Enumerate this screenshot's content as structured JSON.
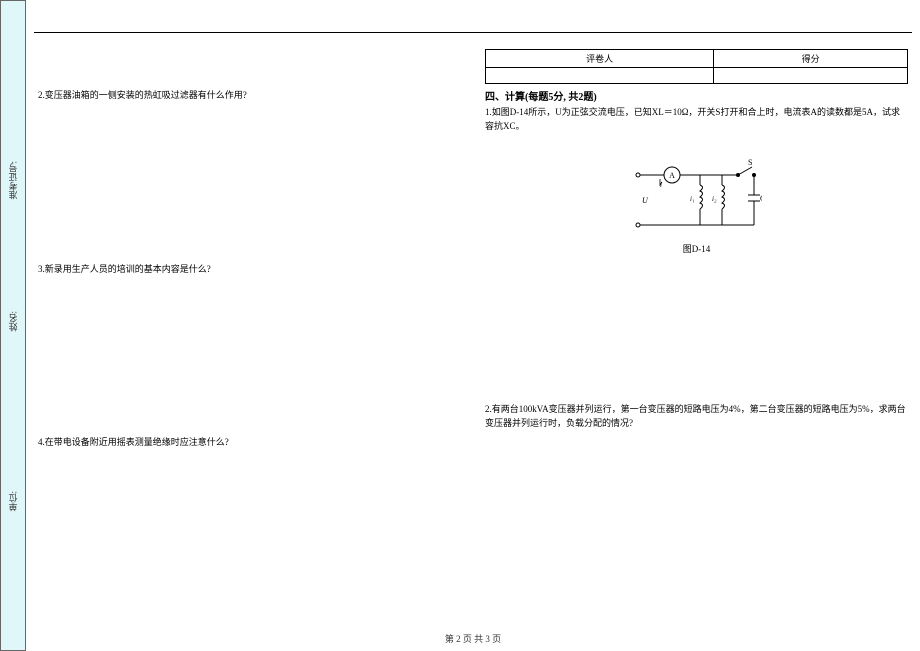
{
  "binding": {
    "label1": "准考证号:",
    "label2": "姓名:",
    "label3": "单位:"
  },
  "leftColumn": {
    "q2": "2.变压器油箱的一侧安装的热虹吸过滤器有什么作用?",
    "q3": "3.新录用生产人员的培训的基本内容是什么?",
    "q4": "4.在带电设备附近用摇表测量绝缘时应注意什么?"
  },
  "rightColumn": {
    "scoring": {
      "grader_label": "评卷人",
      "score_label": "得分"
    },
    "section4_title": "四、计算(每题5分, 共2题)",
    "q1": "1.如图D-14所示，U为正弦交流电压，已知XL＝10Ω，开关S打开和合上时，电流表A的读数都是5A，试求容抗XC。",
    "circuit_caption": "图D-14",
    "q2": "2.有两台100kVA变压器并列运行，第一台变压器的短路电压为4%，第二台变压器的短路电压为5%，求两台变压器并列运行时，负载分配的情况?",
    "circuit_labels": {
      "ammeter": "A",
      "switch": "S",
      "cap": "C",
      "u": "U",
      "i": "i",
      "i1": "i₁",
      "i2": "i₂"
    }
  },
  "footer": "第 2 页 共 3 页"
}
